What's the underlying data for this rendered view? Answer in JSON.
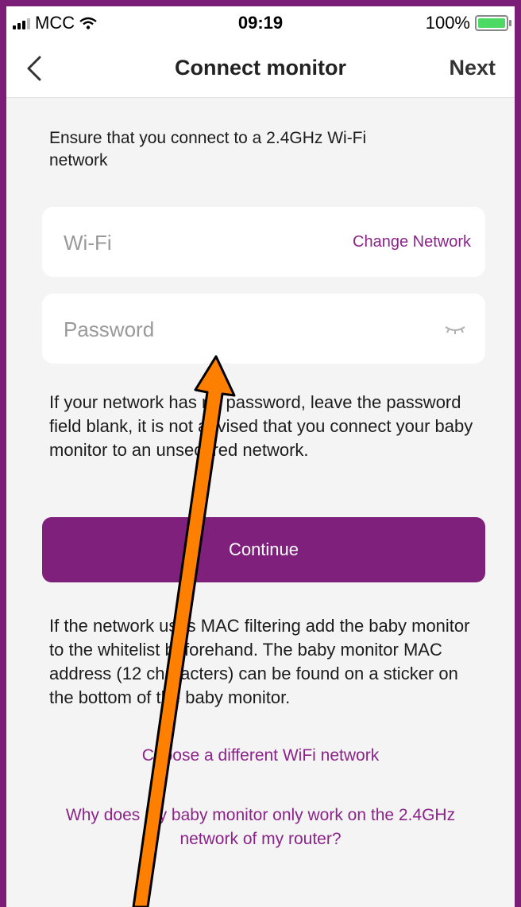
{
  "status_bar": {
    "carrier": "MCC",
    "time": "09:19",
    "battery": "100%"
  },
  "nav": {
    "title": "Connect monitor",
    "next_label": "Next"
  },
  "intro_text": "Ensure that you connect to a 2.4GHz Wi-Fi network",
  "wifi_field": {
    "placeholder": "Wi-Fi",
    "change_label": "Change Network"
  },
  "password_field": {
    "placeholder": "Password"
  },
  "password_note": "If your network has no password, leave the password field blank, it is not advised that you connect your baby monitor to an unsecured network.",
  "continue_label": "Continue",
  "mac_note": "If the network uses MAC filtering add the baby monitor to the whitelist beforehand. The baby monitor MAC address (12 characters) can be found on a sticker on the bottom of the baby monitor.",
  "links": {
    "different_wifi": "Choose a different WiFi network",
    "why_24ghz": "Why does my baby monitor only work on the 2.4GHz network of my router?"
  },
  "colors": {
    "brand_purple": "#7e207c",
    "link_purple": "#8b2489",
    "annotation_arrow": "#ff7f00"
  }
}
